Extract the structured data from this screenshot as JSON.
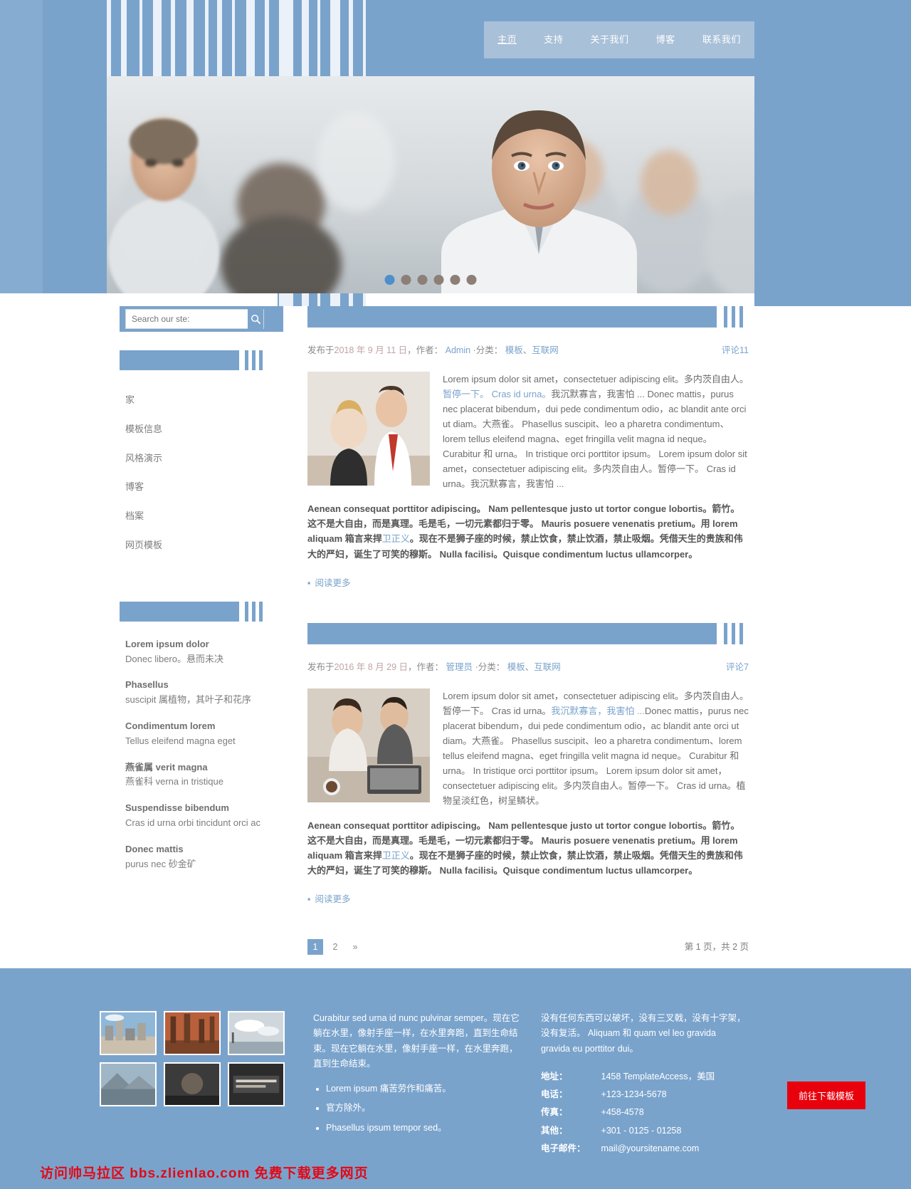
{
  "nav": {
    "items": [
      {
        "label": "主页",
        "active": true
      },
      {
        "label": "支持",
        "active": false
      },
      {
        "label": "关于我们",
        "active": false
      },
      {
        "label": "博客",
        "active": false
      },
      {
        "label": "联系我们",
        "active": false
      }
    ]
  },
  "hero": {
    "slide_count": 6,
    "active_slide": 1
  },
  "sidebar": {
    "search": {
      "placeholder": "Search our ste:",
      "value": "",
      "icon": "search-icon"
    },
    "menu_title": "",
    "menu": [
      {
        "label": "家"
      },
      {
        "label": "模板信息"
      },
      {
        "label": "风格演示"
      },
      {
        "label": "博客"
      },
      {
        "label": "档案"
      },
      {
        "label": "网页模板"
      }
    ],
    "list_title": "",
    "definitions": [
      {
        "term": "Lorem ipsum dolor",
        "desc": "Donec libero。悬而未决"
      },
      {
        "term": "Phasellus",
        "desc": "suscipit 属植物，其叶子和花序"
      },
      {
        "term": "Condimentum lorem",
        "desc": "Tellus eleifend magna eget"
      },
      {
        "term": "燕雀属 verit magna",
        "desc": "燕雀科 verna in tristique"
      },
      {
        "term": "Suspendisse bibendum",
        "desc": "Cras id urna orbi tincidunt orci ac"
      },
      {
        "term": "Donec mattis",
        "desc": "purus nec 砂金矿"
      }
    ]
  },
  "posts": [
    {
      "title": "",
      "meta_prefix": "发布于",
      "date": "2018 年 9 月 11 日",
      "author_label": "，作者：",
      "author": "Admin",
      "cat_label": "·分类：",
      "categories": [
        "模板",
        "互联网"
      ],
      "comments_label": "评论",
      "comments_count": "11",
      "para1_a": "Lorem ipsum dolor sit amet，consectetuer adipiscing elit。多内茨自由人。",
      "para1_link": "暂停一下。 Cras id urna。",
      "para1_b": "我沉默寡言，我害怕 ... Donec mattis，purus nec placerat bibendum，dui pede condimentum odio，ac blandit ante orci ut diam。大燕雀。 Phasellus suscipit、leo a pharetra condimentum、lorem tellus eleifend magna、eget fringilla velit magna id neque。 Curabitur 和 urna。 In tristique orci porttitor ipsum。 Lorem ipsum dolor sit amet，consectetuer adipiscing elit。多内茨自由人。暂停一下。 Cras id urna。我沉默寡言，我害怕 ...",
      "para2_a": "Aenean consequat porttitor adipiscing。 Nam pellentesque justo ut tortor congue lobortis。箭竹。这不是大自由，而是真理。毛是毛，一切元素都归于零。 Mauris posuere venenatis pretium。用 lorem aliquam 箱言来捍",
      "para2_link": "卫正义",
      "para2_b": "。现在不是狮子座的时候，禁止饮食，禁止饮酒，禁止吸烟。凭借天生的贵族和伟大的严妇，诞生了可笑的穆斯。 Nulla facilisi。Quisque condimentum luctus ullamcorper。",
      "readmore": "阅读更多"
    },
    {
      "title": "",
      "meta_prefix": "发布于",
      "date": "2016 年 8 月 29 日",
      "author_label": "，作者：",
      "author": "管理员",
      "cat_label": "·分类：",
      "categories": [
        "模板",
        "互联网"
      ],
      "comments_label": "评论",
      "comments_count": "7",
      "para1_a": "Lorem ipsum dolor sit amet，consectetuer adipiscing elit。多内茨自由人。暂停一下。 Cras id urna。",
      "para1_link": "我沉默寡言，我害怕 ...",
      "para1_b": "Donec mattis，purus nec placerat bibendum，dui pede condimentum odio，ac blandit ante orci ut diam。大燕雀。 Phasellus suscipit、leo a pharetra condimentum、lorem tellus eleifend magna、eget fringilla velit magna id neque。 Curabitur 和 urna。 In tristique orci porttitor ipsum。 Lorem ipsum dolor sit amet，consectetuer adipiscing elit。多内茨自由人。暂停一下。 Cras id urna。植物呈淡红色，树呈鳞状。",
      "para2_a": "Aenean consequat porttitor adipiscing。 Nam pellentesque justo ut tortor congue lobortis。箭竹。这不是大自由，而是真理。毛是毛，一切元素都归于零。 Mauris posuere venenatis pretium。用 lorem aliquam 箱言来捍",
      "para2_link": "卫正义",
      "para2_b": "。现在不是狮子座的时候，禁止饮食，禁止饮酒，禁止吸烟。凭借天生的贵族和伟大的严妇，诞生了可笑的穆斯。 Nulla facilisi。Quisque condimentum luctus ullamcorper。",
      "readmore": "阅读更多"
    }
  ],
  "pager": {
    "pages": [
      "1",
      "2"
    ],
    "current": "1",
    "next_symbol": "»",
    "info": "第 1 页，共 2 页"
  },
  "footer": {
    "about_text": "Curabitur sed urna id nunc pulvinar semper。现在它躺在水里，像射手座一样，在水里奔跑，直到生命结束。现在它躺在水里，像射手座一样，在水里奔跑，直到生命结束。",
    "about_list": [
      "Lorem ipsum 痛苦劳作和痛苦。",
      "官方除外。",
      "Phasellus ipsum tempor sed。"
    ],
    "right_text": "没有任何东西可以破坏，没有三叉戟，没有十字架，没有复活。 Aliquam 和 quam vel leo gravida gravida eu porttitor dui。",
    "contact": [
      {
        "label": "地址：",
        "value": "1458 TemplateAccess，美国"
      },
      {
        "label": "电话：",
        "value": "+123-1234-5678"
      },
      {
        "label": "传真：",
        "value": "+458-4578"
      },
      {
        "label": "其他：",
        "value": "+301 - 0125 - 01258"
      },
      {
        "label": "电子邮件：",
        "value": "mail@yoursitename.com"
      }
    ],
    "download_button": "前往下载模板",
    "watermark": "访问帅马拉区 bbs.zlienlao.com 免费下载更多网页"
  }
}
